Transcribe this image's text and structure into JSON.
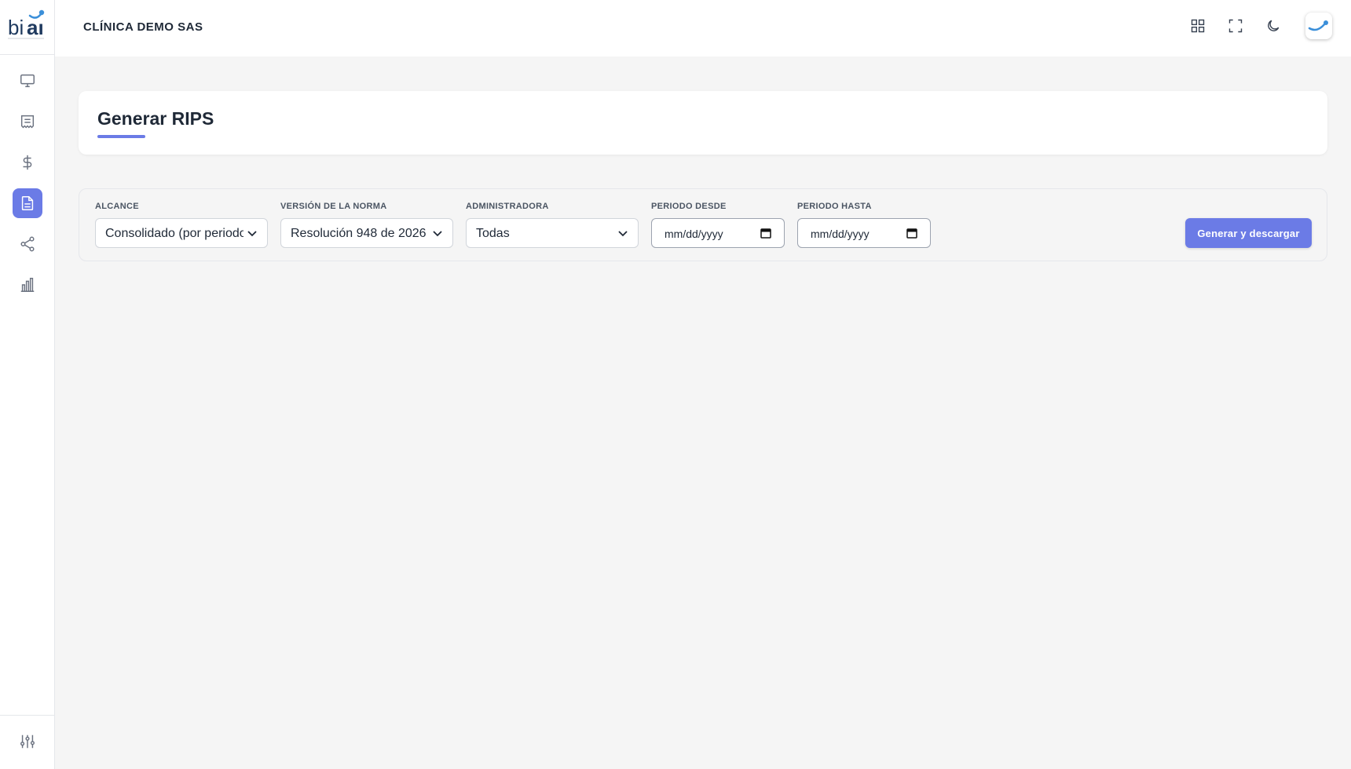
{
  "brand": {
    "logo_text": "biai"
  },
  "header": {
    "clinic_name": "CLÍNICA DEMO SAS"
  },
  "sidebar": {
    "items": [
      {
        "name": "monitor-icon",
        "active": false
      },
      {
        "name": "list-document-icon",
        "active": false
      },
      {
        "name": "dollar-icon",
        "active": false
      },
      {
        "name": "file-text-icon",
        "active": true
      },
      {
        "name": "share-icon",
        "active": false
      },
      {
        "name": "bar-chart-icon",
        "active": false
      }
    ],
    "bottom_item": "sliders-icon"
  },
  "page": {
    "title": "Generar RIPS"
  },
  "filters": {
    "alcance": {
      "label": "ALCANCE",
      "value": "Consolidado (por periodo)"
    },
    "version": {
      "label": "VERSIÓN DE LA NORMA",
      "value": "Resolución 948 de 2026"
    },
    "administradora": {
      "label": "ADMINISTRADORA",
      "value": "Todas"
    },
    "periodo_desde": {
      "label": "PERIODO DESDE",
      "placeholder": "mm/dd/yyyy"
    },
    "periodo_hasta": {
      "label": "PERIODO HASTA",
      "placeholder": "mm/dd/yyyy"
    }
  },
  "actions": {
    "generate_label": "Generar y descargar"
  },
  "colors": {
    "accent": "#6b7be6",
    "background": "#f5f5f5",
    "icon": "#6b7280"
  }
}
